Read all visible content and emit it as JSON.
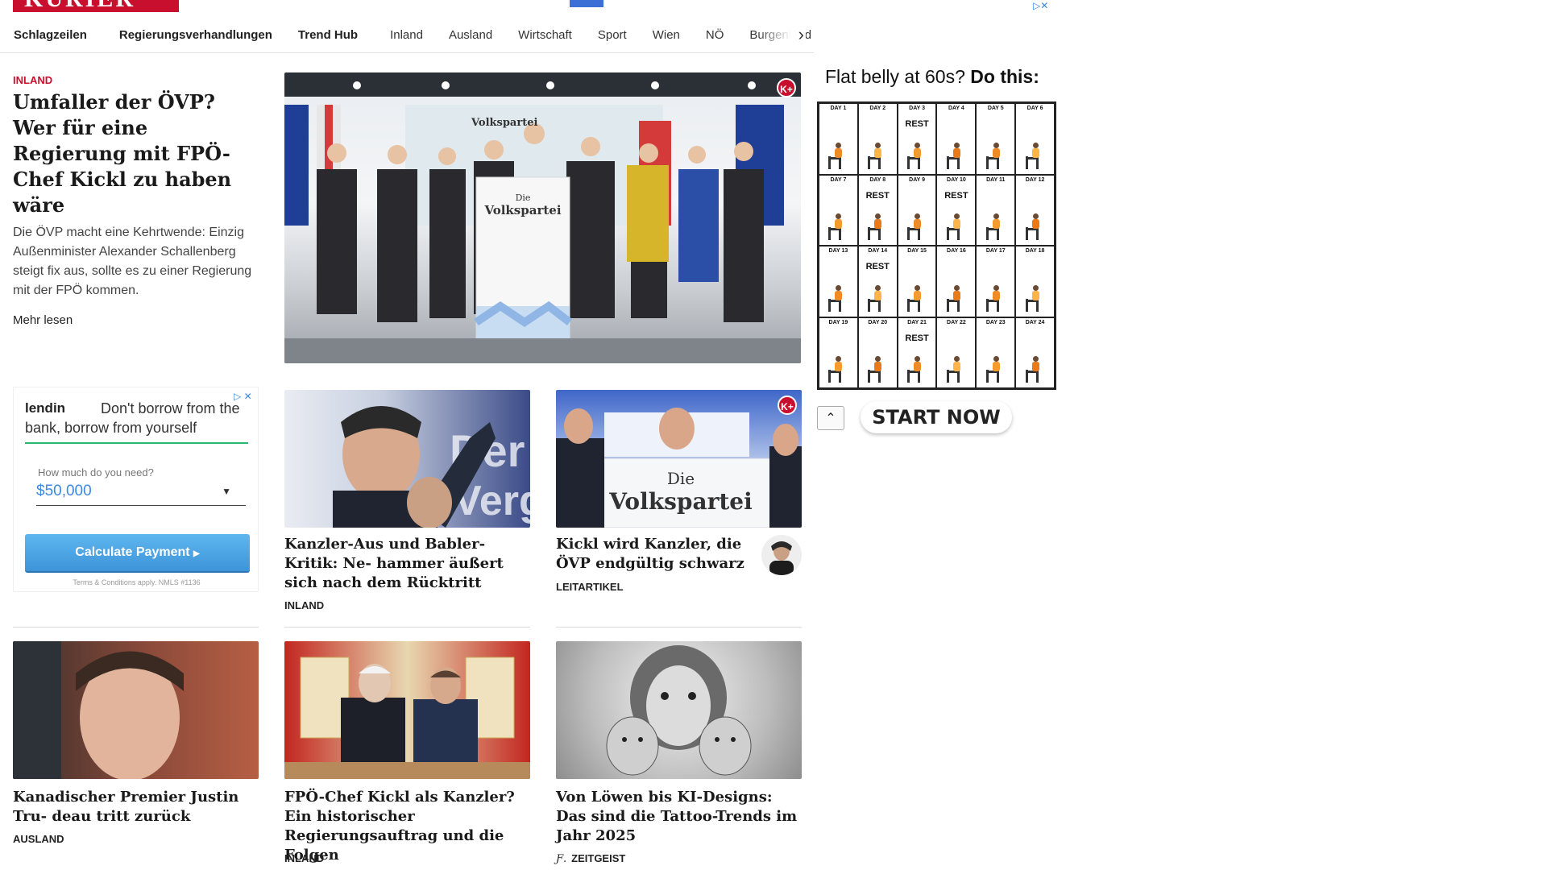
{
  "header": {
    "logo_text": "KURIER"
  },
  "nav": {
    "items": [
      "Schlagzeilen",
      "Regierungsverhandlungen",
      "Trend Hub",
      "Inland",
      "Ausland",
      "Wirtschaft",
      "Sport",
      "Wien",
      "NÖ",
      "Burgenland"
    ],
    "next_arrow": "›"
  },
  "lead": {
    "kicker": "INLAND",
    "title": "Umfaller der ÖVP? Wer für eine Regierung mit FPÖ-Chef Kickl zu haben wäre",
    "teaser": "Die ÖVP macht eine Kehrtwende: Einzig Außenminister Alexander Schallenberg steigt fix aus, sollte es zu einer Regierung mit der FPÖ kommen.",
    "more": "Mehr lesen",
    "image_podium_small": "Die",
    "image_podium_big": "Volkspartei"
  },
  "cards": [
    {
      "title": "Kanzler-Aus und Babler-Kritik: Ne- hammer äußert sich nach dem Rücktritt",
      "kicker": "INLAND"
    },
    {
      "title": "Kickl wird Kanzler, die ÖVP endgültig schwarz",
      "kicker": "LEITARTIKEL",
      "banner_small": "Die",
      "banner_big": "Volkspartei"
    },
    {
      "title": "Kanadischer Premier Justin Tru- deau tritt zurück",
      "kicker": "AUSLAND"
    },
    {
      "title": "FPÖ-Chef Kickl als Kanzler? Ein historischer Regierungsauftrag und die Folgen",
      "kicker": "INLAND"
    },
    {
      "title": "Von Löwen bis KI-Designs: Das sind die Tattoo-Trends im Jahr 2025",
      "kicker": "ZEITGEIST"
    }
  ],
  "badge_kplus": "K+",
  "ad_left": {
    "brand": "lendin",
    "headline": "Don't borrow from the bank, borrow from yourself",
    "question": "How much do you need?",
    "amount": "$50,000",
    "button": "Calculate Payment",
    "terms": "Terms & Conditions apply. NMLS #1136"
  },
  "ad_right": {
    "title_plain": "Flat belly at 60s?",
    "title_bold": "Do this:",
    "days": [
      {
        "day": "DAY 1",
        "rest": ""
      },
      {
        "day": "DAY 2",
        "rest": ""
      },
      {
        "day": "DAY 3",
        "rest": "REST"
      },
      {
        "day": "DAY 4",
        "rest": ""
      },
      {
        "day": "DAY 5",
        "rest": ""
      },
      {
        "day": "DAY 6",
        "rest": ""
      },
      {
        "day": "DAY 7",
        "rest": ""
      },
      {
        "day": "DAY 8",
        "rest": "REST"
      },
      {
        "day": "DAY 9",
        "rest": ""
      },
      {
        "day": "DAY 10",
        "rest": "REST"
      },
      {
        "day": "DAY 11",
        "rest": ""
      },
      {
        "day": "DAY 12",
        "rest": ""
      },
      {
        "day": "DAY 13",
        "rest": ""
      },
      {
        "day": "DAY 14",
        "rest": "REST"
      },
      {
        "day": "DAY 15",
        "rest": ""
      },
      {
        "day": "DAY 16",
        "rest": ""
      },
      {
        "day": "DAY 17",
        "rest": ""
      },
      {
        "day": "DAY 18",
        "rest": ""
      },
      {
        "day": "DAY 19",
        "rest": ""
      },
      {
        "day": "DAY 20",
        "rest": ""
      },
      {
        "day": "DAY 21",
        "rest": "REST"
      },
      {
        "day": "DAY 22",
        "rest": ""
      },
      {
        "day": "DAY 23",
        "rest": ""
      },
      {
        "day": "DAY 24",
        "rest": ""
      }
    ],
    "cta": "START NOW"
  },
  "colors": {
    "brand": "#c8102e",
    "accent_blue": "#3b89e0"
  }
}
